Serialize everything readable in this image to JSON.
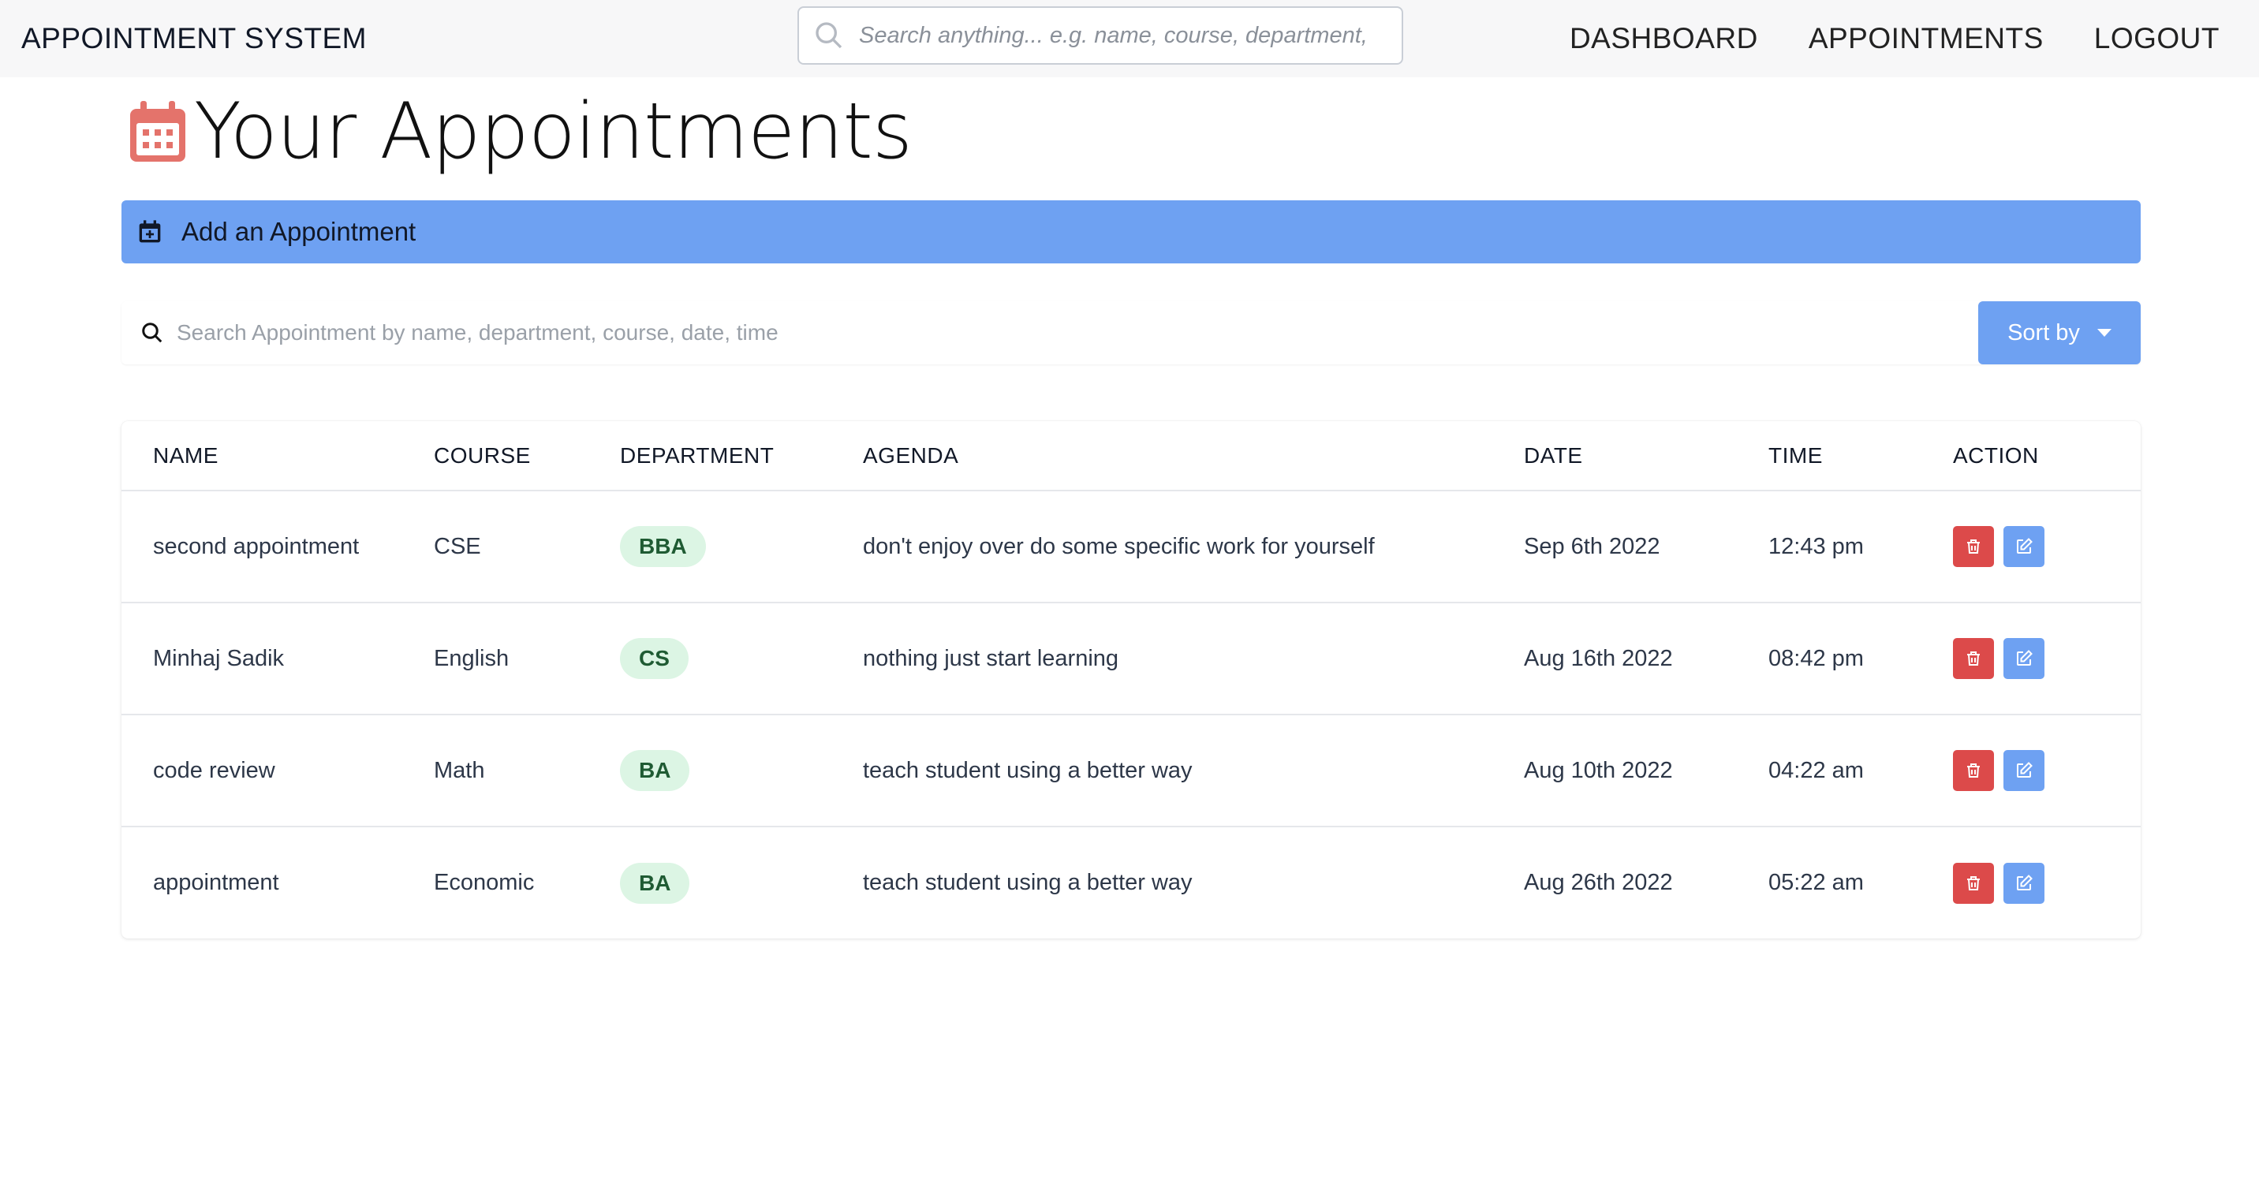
{
  "app": {
    "title": "APPOINTMENT SYSTEM"
  },
  "nav": {
    "search_placeholder": "Search anything... e.g. name, course, department,",
    "links": [
      "DASHBOARD",
      "APPOINTMENTS",
      "LOGOUT"
    ]
  },
  "page": {
    "title": "Your Appointments",
    "title_icon": "calendar-icon",
    "add_label": "Add an Appointment",
    "search_placeholder": "Search Appointment by name, department, course, date, time",
    "sort_label": "Sort by"
  },
  "table": {
    "headers": [
      "NAME",
      "COURSE",
      "DEPARTMENT",
      "AGENDA",
      "DATE",
      "TIME",
      "ACTION"
    ],
    "rows": [
      {
        "name": "second appointment",
        "course": "CSE",
        "department": "BBA",
        "agenda": "don't enjoy over do some specific work for yourself",
        "date": "Sep 6th 2022",
        "time": "12:43 pm"
      },
      {
        "name": "Minhaj Sadik",
        "course": "English",
        "department": "CS",
        "agenda": "nothing just start learning",
        "date": "Aug 16th 2022",
        "time": "08:42 pm"
      },
      {
        "name": "code review",
        "course": "Math",
        "department": "BA",
        "agenda": "teach student using a better way",
        "date": "Aug 10th 2022",
        "time": "04:22 am"
      },
      {
        "name": "appointment",
        "course": "Economic",
        "department": "BA",
        "agenda": "teach student using a better way",
        "date": "Aug 26th 2022",
        "time": "05:22 am"
      }
    ]
  },
  "colors": {
    "primary": "#6ea1f2",
    "danger": "#dc4a4a",
    "badge_bg": "#dcf5e4",
    "badge_text": "#1f5b33",
    "calendar_icon": "#e4736b",
    "navbar_bg": "#f7f7f8"
  },
  "icons": {
    "nav_search": "search-icon",
    "add": "calendar-plus-icon",
    "search": "search-icon",
    "sort": "caret-down-icon",
    "delete": "trash-icon",
    "edit": "edit-icon"
  }
}
